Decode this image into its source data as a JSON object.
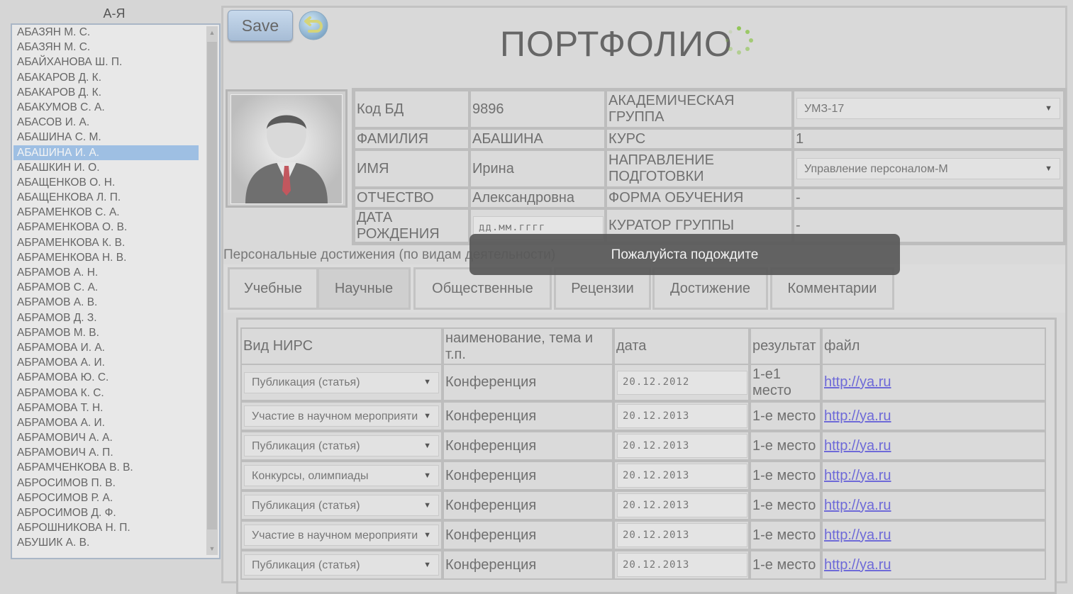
{
  "sidebar": {
    "header": "А-Я",
    "items": [
      "АБАЗЯН М. С.",
      "АБАЗЯН М. С.",
      "АБАЙХАНОВА Ш. П.",
      "АБАКАРОВ Д. К.",
      "АБАКАРОВ Д. К.",
      "АБАКУМОВ С. А.",
      "АБАСОВ И. А.",
      "АБАШИНА С. М.",
      "АБАШИНА И. А.",
      "АБАШКИН И. О.",
      "АБАЩЕНКОВ О. Н.",
      "АБАЩЕНКОВА Л. П.",
      "АБРАМЕНКОВ С. А.",
      "АБРАМЕНКОВА О. В.",
      "АБРАМЕНКОВА К. В.",
      "АБРАМЕНКОВА Н. В.",
      "АБРАМОВ А. Н.",
      "АБРАМОВ С. А.",
      "АБРАМОВ А. В.",
      "АБРАМОВ Д. З.",
      "АБРАМОВ М. В.",
      "АБРАМОВА И. А.",
      "АБРАМОВА А. И.",
      "АБРАМОВА Ю. С.",
      "АБРАМОВА К. С.",
      "АБРАМОВА Т. Н.",
      "АБРАМОВА А. И.",
      "АБРАМОВИЧ А. А.",
      "АБРАМОВИЧ А. П.",
      "АБРАМЧЕНКОВА В. В.",
      "АБРОСИМОВ П. В.",
      "АБРОСИМОВ Р. А.",
      "АБРОСИМОВ Д. Ф.",
      "АБРОШНИКОВА Н. П.",
      "АБУШИК А. В."
    ],
    "selected_index": 8
  },
  "toolbar": {
    "save_label": "Save"
  },
  "page_title": "ПОРТФОЛИО",
  "info": {
    "db_code_label": "Код БД",
    "db_code_value": "9896",
    "surname_label": "ФАМИЛИЯ",
    "surname_value": "АБАШИНА",
    "name_label": "ИМЯ",
    "name_value": "Ирина",
    "patronymic_label": "ОТЧЕСТВО",
    "patronymic_value": "Александровна",
    "birth_label": "ДАТА РОЖДЕНИЯ",
    "birth_placeholder": "дд.мм.гггг",
    "group_label": "АКАДЕМИЧЕСКАЯ ГРУППА",
    "group_value": "УМЗ-17",
    "course_label": "КУРС",
    "course_value": "1",
    "direction_label": "НАПРАВЛЕНИЕ ПОДГОТОВКИ",
    "direction_value": "Управление персоналом-М",
    "form_label": "ФОРМА ОБУЧЕНИЯ",
    "form_value": "-",
    "curator_label": "КУРАТОР ГРУППЫ",
    "curator_value": "-"
  },
  "achievements_label": "Персональные достижения (по видам деятельности)",
  "overlay_text": "Пожалуйста подождите",
  "tabs": [
    "Учебные",
    "Научные",
    "Общественные",
    "Рецензии",
    "Достижение",
    "Комментарии"
  ],
  "active_tab": 1,
  "grid": {
    "headers": [
      "Вид НИРС",
      "наименование, тема и т.п.",
      "дата",
      "результат",
      "файл"
    ],
    "rows": [
      {
        "type": "Публикация (статья)",
        "name": "Конференция",
        "date": "20.12.2012",
        "result": "1-е1 место",
        "file": "http://ya.ru"
      },
      {
        "type": "Участие в научном мероприяти",
        "name": "Конференция",
        "date": "20.12.2013",
        "result": "1-е место",
        "file": "http://ya.ru"
      },
      {
        "type": "Публикация (статья)",
        "name": "Конференция",
        "date": "20.12.2013",
        "result": "1-е место",
        "file": "http://ya.ru"
      },
      {
        "type": "Конкурсы, олимпиады",
        "name": "Конференция",
        "date": "20.12.2013",
        "result": "1-е место",
        "file": "http://ya.ru"
      },
      {
        "type": "Публикация (статья)",
        "name": "Конференция",
        "date": "20.12.2013",
        "result": "1-е место",
        "file": "http://ya.ru"
      },
      {
        "type": "Участие в научном мероприяти",
        "name": "Конференция",
        "date": "20.12.2013",
        "result": "1-е место",
        "file": "http://ya.ru"
      },
      {
        "type": "Публикация (статья)",
        "name": "Конференция",
        "date": "20.12.2013",
        "result": "1-е место",
        "file": "http://ya.ru"
      }
    ]
  },
  "icons": {
    "save": "save-button",
    "undo": "undo-icon",
    "loader": "loader-icon",
    "avatar": "user-avatar-icon",
    "dropdown": "chevron-down-icon"
  },
  "colors": {
    "selection": "#9ebfe3",
    "overlay": "#585858",
    "link": "#6e6ad8",
    "loader": "#8bc34a"
  }
}
